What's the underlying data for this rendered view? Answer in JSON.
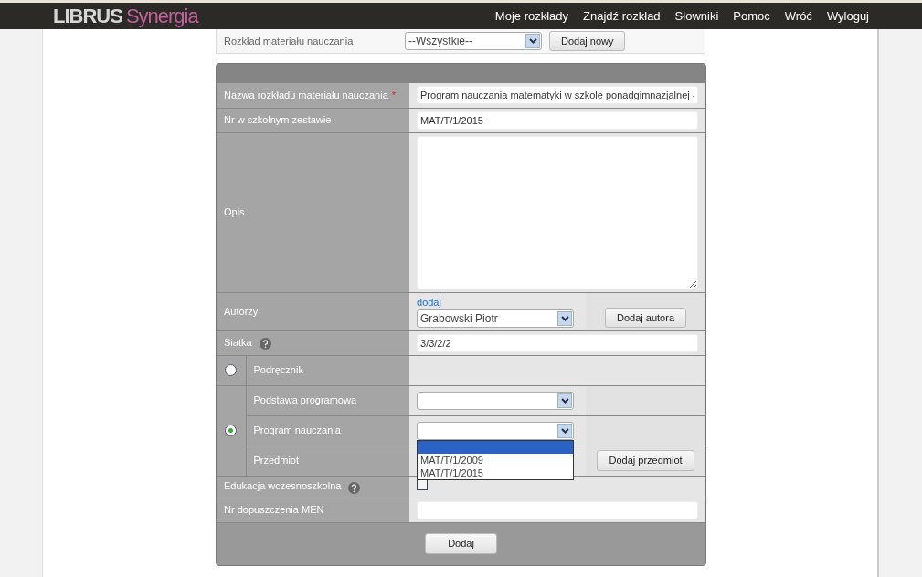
{
  "nav": {
    "logo_main": "LIBRUS",
    "logo_accent": "Synergia",
    "links": [
      "Moje rozkłady",
      "Znajdź rozkład",
      "Słowniki",
      "Pomoc",
      "Wróć",
      "Wyloguj"
    ]
  },
  "filter": {
    "label": "Rozkład materiału nauczania",
    "select_value": "--Wszystkie--",
    "button": "Dodaj nowy"
  },
  "form": {
    "rows": [
      {
        "kind": "text",
        "label": "Nazwa rozkładu materiału nauczania",
        "required_mark": "*",
        "value": "Program nauczania matematyki w szkole ponadgimnazjalnej -"
      },
      {
        "kind": "text",
        "label": "Nr w szkolnym zestawie",
        "value": "MAT/T/1/2015"
      },
      {
        "kind": "textarea",
        "label": "Opis"
      },
      {
        "kind": "authors",
        "label": "Autorzy",
        "link": "dodaj",
        "select_value": "Grabowski Piotr",
        "button": "Dodaj autora"
      },
      {
        "kind": "text",
        "label": "Siatka",
        "help": true,
        "value": "3/3/2/2"
      },
      {
        "kind": "choice",
        "options": [
          {
            "selected": false,
            "rows": [
              {
                "kind": "plain",
                "label": "Podręcznik"
              }
            ]
          },
          {
            "selected": true,
            "rows": [
              {
                "kind": "select",
                "label": "Podstawa programowa"
              },
              {
                "kind": "select",
                "label": "Program nauczania",
                "open": true,
                "options": [
                  {
                    "selected": true
                  },
                  {
                    "label": "MAT/T/1/2009",
                    "selected": false
                  },
                  {
                    "label": "MAT/T/1/2015",
                    "selected": false
                  }
                ]
              },
              {
                "kind": "button",
                "label": "Przedmiot",
                "button": "Dodaj przedmiot"
              }
            ]
          }
        ]
      },
      {
        "kind": "checkbox",
        "label": "Edukacja wczesnoszkolna",
        "help": true,
        "checked": false
      },
      {
        "kind": "text",
        "label": "Nr dopuszczenia MEN"
      }
    ],
    "submit": "Dodaj"
  }
}
